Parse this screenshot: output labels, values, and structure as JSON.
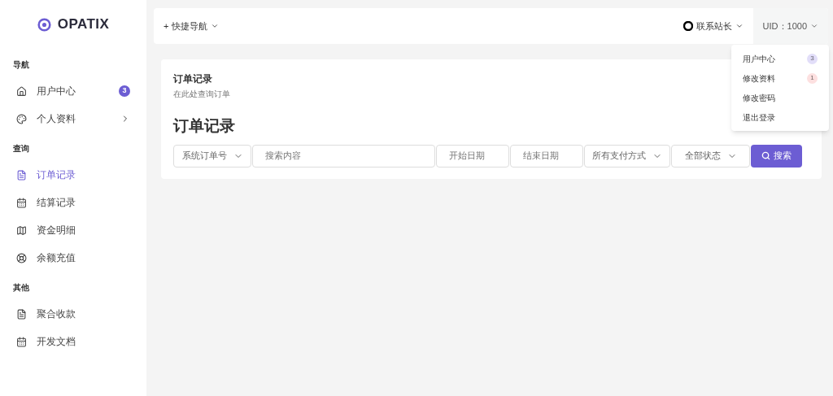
{
  "logo": {
    "text": "OPATIX"
  },
  "sidebar": {
    "sections": [
      {
        "title": "导航",
        "items": [
          {
            "label": "用户中心",
            "selected": false,
            "badge": "3",
            "color": "#6c5dd3"
          },
          {
            "label": "个人资料",
            "selected": false,
            "expandable": true
          }
        ]
      },
      {
        "title": "查询",
        "items": [
          {
            "label": "订单记录",
            "selected": true
          },
          {
            "label": "结算记录",
            "selected": false
          },
          {
            "label": "资金明细",
            "selected": false
          },
          {
            "label": "余额充值",
            "selected": false
          }
        ]
      },
      {
        "title": "其他",
        "items": [
          {
            "label": "聚合收款",
            "selected": false
          },
          {
            "label": "开发文档",
            "selected": false
          }
        ]
      }
    ]
  },
  "topbar": {
    "quick_nav": {
      "icon": "+",
      "label": "快捷导航"
    },
    "contact": "联系站长",
    "uid": "UID：1000"
  },
  "user_menu": {
    "items": [
      {
        "label": "用户中心",
        "badge": "3",
        "color": "#e2def9"
      },
      {
        "label": "修改资料",
        "badge": "1",
        "color": "#fde0e0"
      },
      {
        "label": "修改密码"
      },
      {
        "label": "退出登录"
      }
    ]
  },
  "card": {
    "title": "订单记录",
    "subtitle": "在此处查询订单",
    "heading": "订单记录"
  },
  "filters": [
    {
      "kind": "select",
      "value": "系统订单号"
    },
    {
      "kind": "input",
      "placeholder": "搜索内容"
    },
    {
      "kind": "input",
      "placeholder": "开始日期"
    },
    {
      "kind": "input",
      "placeholder": "结束日期"
    },
    {
      "kind": "select",
      "value": "所有支付方式"
    },
    {
      "kind": "select",
      "value": "全部状态"
    }
  ],
  "search_button": "搜索"
}
